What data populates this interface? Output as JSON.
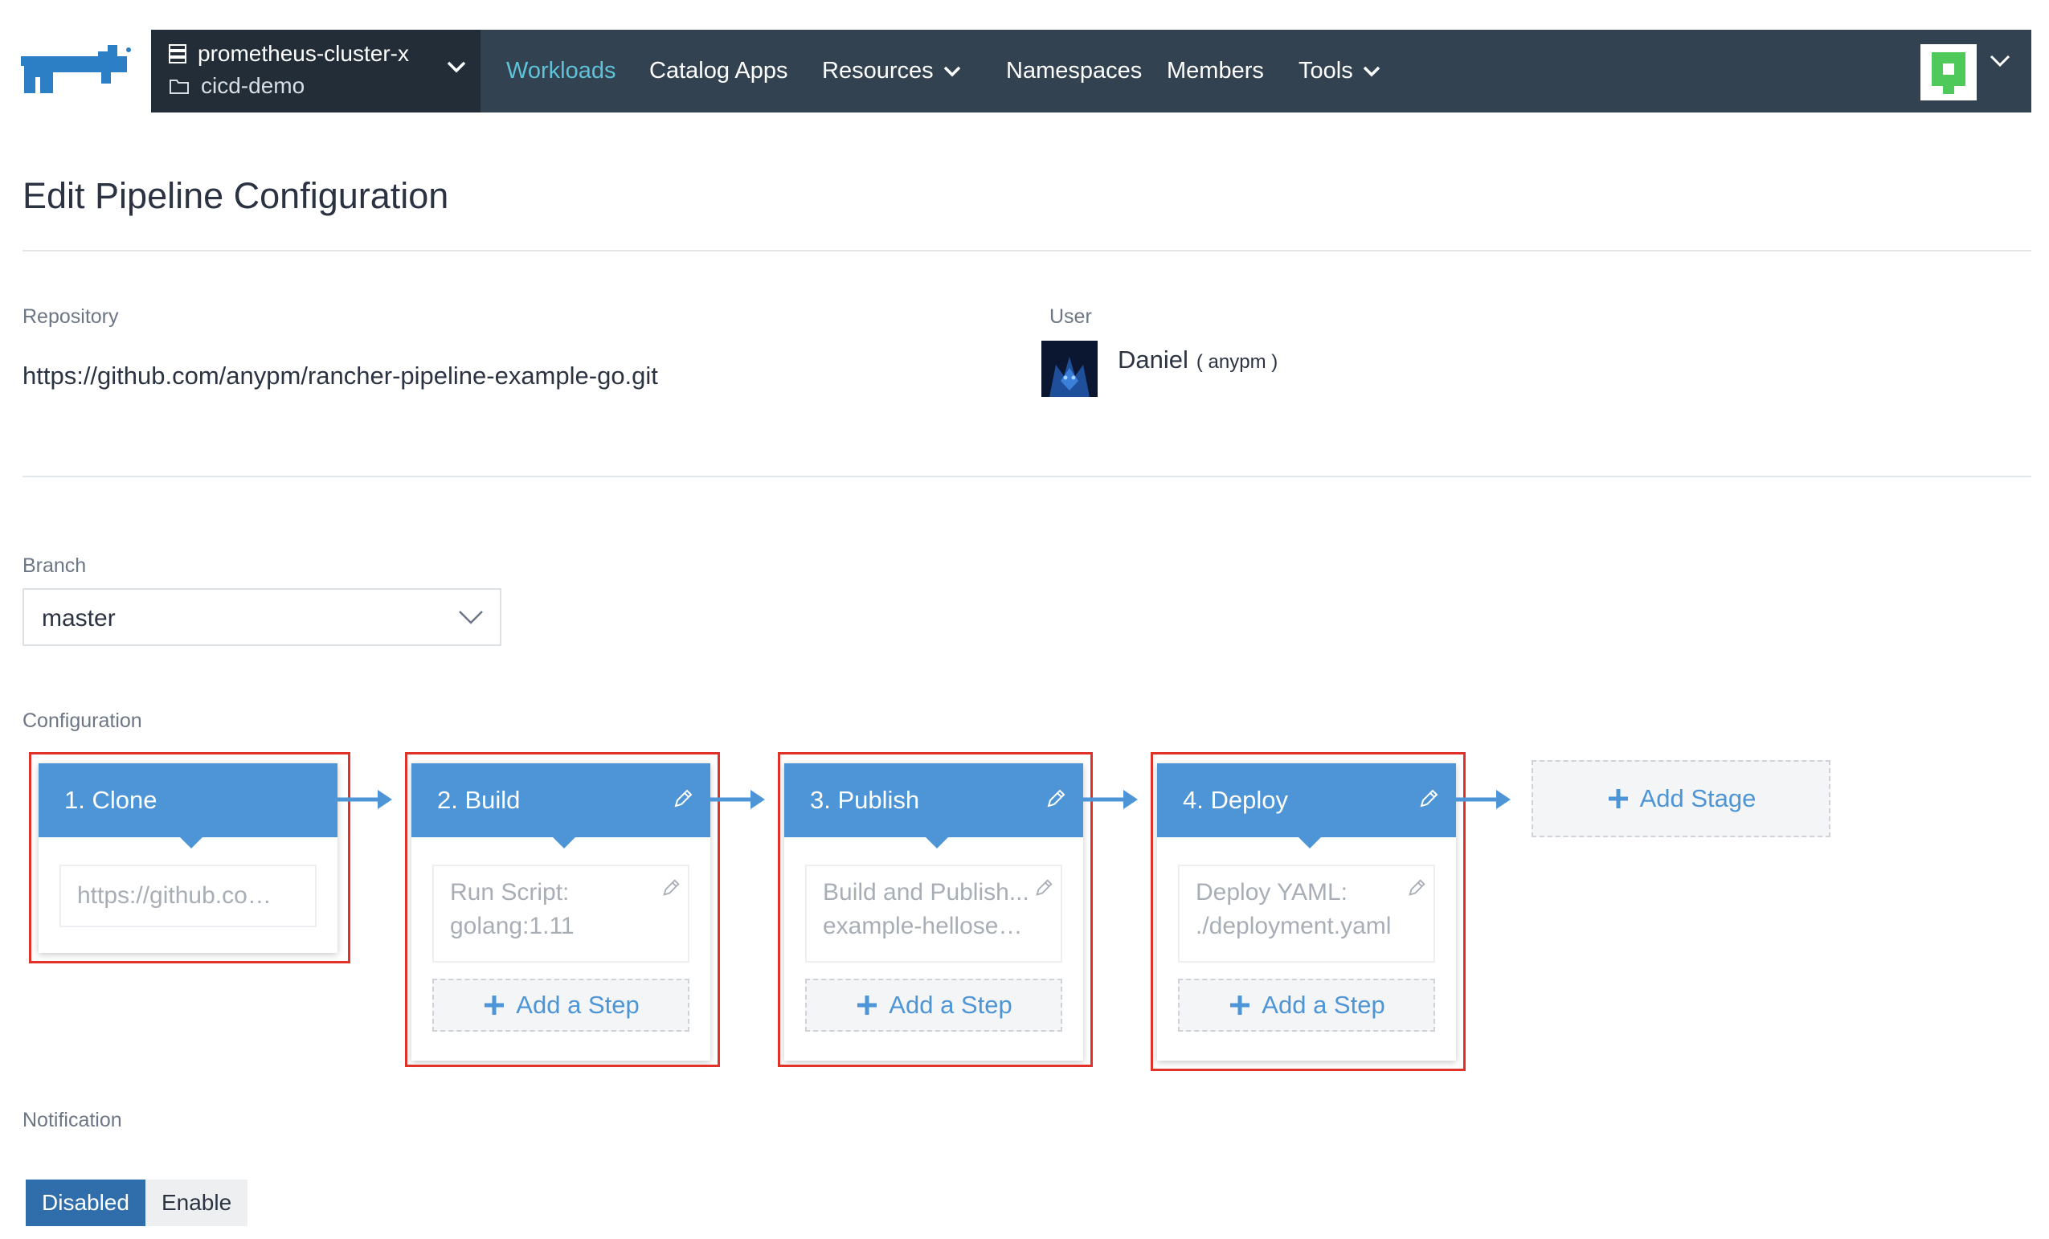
{
  "header": {
    "cluster_name": "prometheus-cluster-x",
    "project_name": "cicd-demo",
    "nav": [
      {
        "label": "Workloads",
        "active": true
      },
      {
        "label": "Catalog Apps"
      },
      {
        "label": "Resources",
        "has_dropdown": true
      },
      {
        "label": "Namespaces"
      },
      {
        "label": "Members"
      },
      {
        "label": "Tools",
        "has_dropdown": true
      }
    ],
    "colors": {
      "bar": "#334250",
      "cluster_box": "#232d38",
      "active": "#5ec2d8"
    }
  },
  "page": {
    "title": "Edit Pipeline Configuration",
    "repository_label": "Repository",
    "repository_url": "https://github.com/anypm/rancher-pipeline-example-go.git",
    "user_label": "User",
    "user_name": "Daniel",
    "user_login": "( anypm )",
    "branch_label": "Branch",
    "branch_value": "master",
    "configuration_label": "Configuration",
    "notification_label": "Notification"
  },
  "stages": [
    {
      "title": "1. Clone",
      "step_lines": [
        "https://github.com..."
      ],
      "editable": false
    },
    {
      "title": "2. Build",
      "step_lines": [
        "Run Script:",
        "golang:1.11"
      ],
      "editable": true,
      "add_step": "Add a Step"
    },
    {
      "title": "3. Publish",
      "step_lines": [
        "Build and Publish...",
        "example-helloserv..."
      ],
      "editable": true,
      "add_step": "Add a Step"
    },
    {
      "title": "4. Deploy",
      "step_lines": [
        "Deploy YAML:",
        "./deployment.yaml"
      ],
      "editable": true,
      "add_step": "Add a Step"
    }
  ],
  "add_stage_label": "Add Stage",
  "notification": {
    "disabled_label": "Disabled",
    "enable_label": "Enable",
    "selected": "Disabled"
  },
  "colors": {
    "accent": "#4d95d6",
    "highlight": "#e1322a",
    "toggle_on": "#2f6eaa"
  }
}
